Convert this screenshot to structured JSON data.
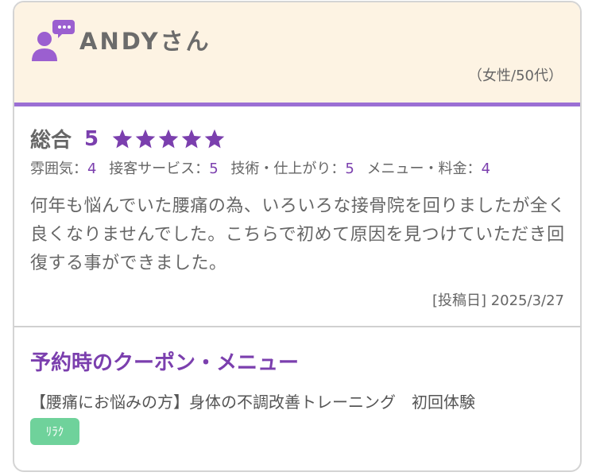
{
  "reviewer": {
    "name": "ANDYさん",
    "demographic": "（女性/50代）"
  },
  "rating": {
    "overall_label": "総合",
    "overall_score": "5",
    "stars_filled": 5,
    "stars_total": 5,
    "subscores": [
      {
        "label": "雰囲気：",
        "value": "4"
      },
      {
        "label": "接客サービス：",
        "value": "5"
      },
      {
        "label": "技術・仕上がり：",
        "value": "5"
      },
      {
        "label": "メニュー・料金：",
        "value": "4"
      }
    ]
  },
  "review_text": "何年も悩んでいた腰痛の為、いろいろな接骨院を回りましたが全く良くなりませんでした。こちらで初めて原因を見つけていただき回復する事ができました。",
  "posted": "[投稿日] 2025/3/27",
  "coupon": {
    "title": "予約時のクーポン・メニュー",
    "text": "【腰痛にお悩みの方】身体の不調改善トレーニング　初回体験",
    "tag": "ﾘﾗｸ"
  },
  "colors": {
    "accent": "#7b3fae",
    "header_bg": "#fdf3e3",
    "header_border": "#9b6fd4",
    "tag_bg": "#6fd29b"
  }
}
